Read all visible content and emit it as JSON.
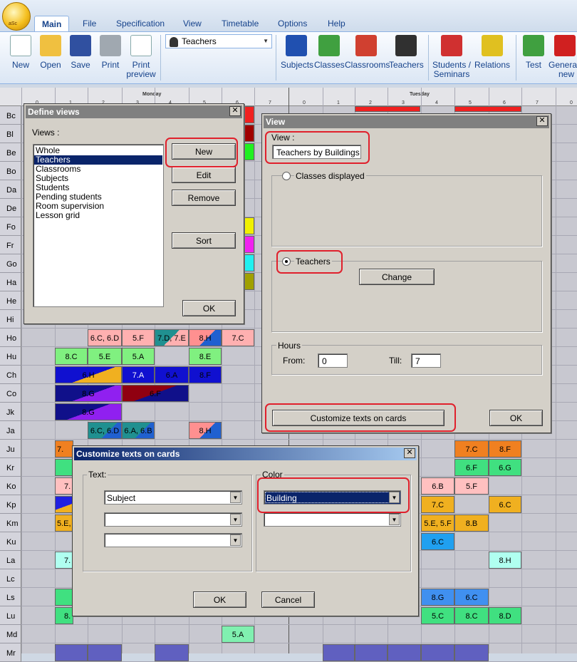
{
  "ribbon": {
    "orb_label": "aSc",
    "tabs": [
      "Main",
      "File",
      "Specification",
      "View",
      "Timetable",
      "Options",
      "Help"
    ],
    "buttons": {
      "new": "New",
      "open": "Open",
      "save": "Save",
      "print": "Print",
      "print_preview_1": "Print",
      "print_preview_2": "preview",
      "subjects": "Subjects",
      "classes": "Classes",
      "classrooms": "Classrooms",
      "teachers": "Teachers",
      "students_1": "Students /",
      "students_2": "Seminars",
      "relations": "Relations",
      "test": "Test",
      "generate_1": "Genera",
      "generate_2": "new"
    },
    "view_select": "Teachers"
  },
  "grid": {
    "days": [
      "Monday",
      "Tuesday"
    ],
    "period_numbers": [
      "0",
      "1",
      "2",
      "3",
      "4",
      "5",
      "6",
      "7",
      "0",
      "1",
      "2",
      "3",
      "4",
      "5",
      "6",
      "7",
      "0"
    ],
    "rows": [
      "Bc",
      "Bl",
      "Be",
      "Bo",
      "Da",
      "De",
      "Fo",
      "Fr",
      "Go",
      "Ha",
      "He",
      "Hi",
      "Ho",
      "Hu",
      "Ch",
      "Co",
      "Jk",
      "Ja",
      "Ju",
      "Kr",
      "Ko",
      "Kp",
      "Km",
      "Ku",
      "La",
      "Lc",
      "Ls",
      "Lu",
      "Md",
      "Mr"
    ],
    "cards": {
      "ho1": "6.C, 6.D",
      "ho2": "5.F",
      "ho3": "7.D, 7.E",
      "ho4": "8.H",
      "ho5": "7.C",
      "hu1": "8.C",
      "hu2": "5.E",
      "hu3": "5.A",
      "hu4": "8.E",
      "ch1": "6.H",
      "ch2": "7.A",
      "ch3": "6.A",
      "ch4": "8.F",
      "co1": "8.G",
      "co2": "6.F",
      "jk1": "8.G",
      "ja1": "6.C, 6.D",
      "ja2": "6.A, 6.B",
      "ja3": "8.H",
      "ju1": "7.",
      "ju2": "7.C",
      "ju3": "8.F",
      "kr1": "6.F",
      "kr2": "6.G",
      "ko1": "7.",
      "ko2": "6.B",
      "ko3": "5.F",
      "kp1": "7.C",
      "kp2": "6.C",
      "km1": "5.E,",
      "km2": "5.E, 5.F",
      "km3": "8.B",
      "ku1": "6.C",
      "la1": "7.",
      "la2": "8.H",
      "ls1": "8.G",
      "ls2": "6.C",
      "lu1": "8.",
      "lu2": "5.C",
      "lu3": "8.C",
      "lu4": "8.D",
      "md1": "5.A"
    }
  },
  "define_views": {
    "title": "Define views",
    "views_label": "Views :",
    "items": [
      "Whole",
      "Teachers",
      "Classrooms",
      "Subjects",
      "Students",
      "Pending students",
      "Room supervision",
      "Lesson grid"
    ],
    "selected": "Teachers",
    "new_label": "New",
    "edit_label": "Edit",
    "remove_label": "Remove",
    "sort_label": "Sort",
    "ok_label": "OK"
  },
  "view_dialog": {
    "title": "View",
    "view_label": "View :",
    "view_name": "Teachers by Buildings",
    "classes_label": "Classes displayed",
    "teachers_label": "Teachers",
    "change_label": "Change",
    "hours_label": "Hours",
    "from_label": "From:",
    "from_value": "0",
    "till_label": "Till:",
    "till_value": "7",
    "customize_label": "Customize texts on cards",
    "ok_label": "OK"
  },
  "customize_dialog": {
    "title": "Customize texts on cards",
    "text_label": "Text:",
    "text_values": [
      "Subject",
      "",
      ""
    ],
    "color_label": "Color",
    "color_values": [
      "Building",
      ""
    ],
    "ok_label": "OK",
    "cancel_label": "Cancel"
  },
  "colors": {
    "highlight": "#e0202c",
    "selection": "#0a246a",
    "title_dark": "#0a246a",
    "title_light": "#a6caf0"
  }
}
